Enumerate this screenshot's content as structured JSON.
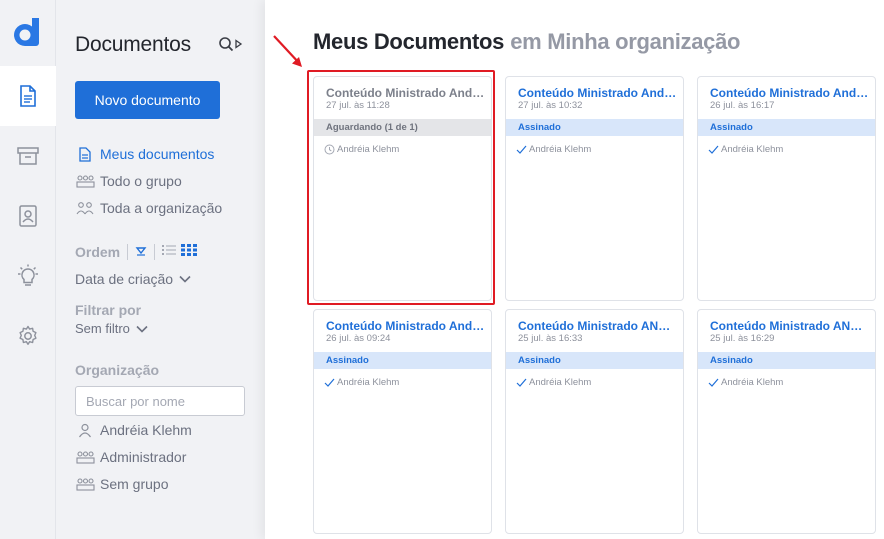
{
  "sidebar": {
    "title": "Documentos",
    "new_button": "Novo documento",
    "nav": [
      {
        "label": "Meus documentos"
      },
      {
        "label": "Todo o grupo"
      },
      {
        "label": "Toda a organização"
      }
    ],
    "order_label": "Ordem",
    "order_value": "Data de criação",
    "filter_label": "Filtrar por",
    "filter_value": "Sem filtro",
    "org_label": "Organização",
    "org_search_placeholder": "Buscar por nome",
    "org_items": [
      {
        "label": "Andréia Klehm"
      },
      {
        "label": "Administrador"
      },
      {
        "label": "Sem grupo"
      }
    ]
  },
  "main": {
    "title": "Meus Documentos",
    "subtitle": "em Minha organização",
    "documents": [
      {
        "title": "Conteúdo Ministrado Andréia",
        "date": "27 jul. às 11:28",
        "status": "Aguardando (1 de 1)",
        "signer": "Andréia Klehm",
        "state": "pending"
      },
      {
        "title": "Conteúdo Ministrado Andréia",
        "date": "27 jul. às 10:32",
        "status": "Assinado",
        "signer": "Andréia Klehm",
        "state": "signed"
      },
      {
        "title": "Conteúdo Ministrado Andréia",
        "date": "26 jul. às 16:17",
        "status": "Assinado",
        "signer": "Andréia Klehm",
        "state": "signed"
      },
      {
        "title": "Conteúdo Ministrado Andréia",
        "date": "26 jul. às 09:24",
        "status": "Assinado",
        "signer": "Andréia Klehm",
        "state": "signed"
      },
      {
        "title": "Conteúdo Ministrado ANDRÉIA",
        "date": "25 jul. às 16:33",
        "status": "Assinado",
        "signer": "Andréia Klehm",
        "state": "signed"
      },
      {
        "title": "Conteúdo Ministrado ANDRÉIA",
        "date": "25 jul. às 16:29",
        "status": "Assinado",
        "signer": "Andréia Klehm",
        "state": "signed"
      }
    ]
  },
  "colors": {
    "accent": "#1f6fd8",
    "highlight": "#e01b24",
    "status_signed_bg": "#d8e6fa",
    "status_pending_bg": "#e4e5e8"
  },
  "icons": {
    "rail": [
      "app-logo",
      "document-icon",
      "archive-icon",
      "contacts-icon",
      "lightbulb-icon",
      "gear-icon"
    ],
    "signed": "check-icon",
    "pending": "clock-icon"
  }
}
